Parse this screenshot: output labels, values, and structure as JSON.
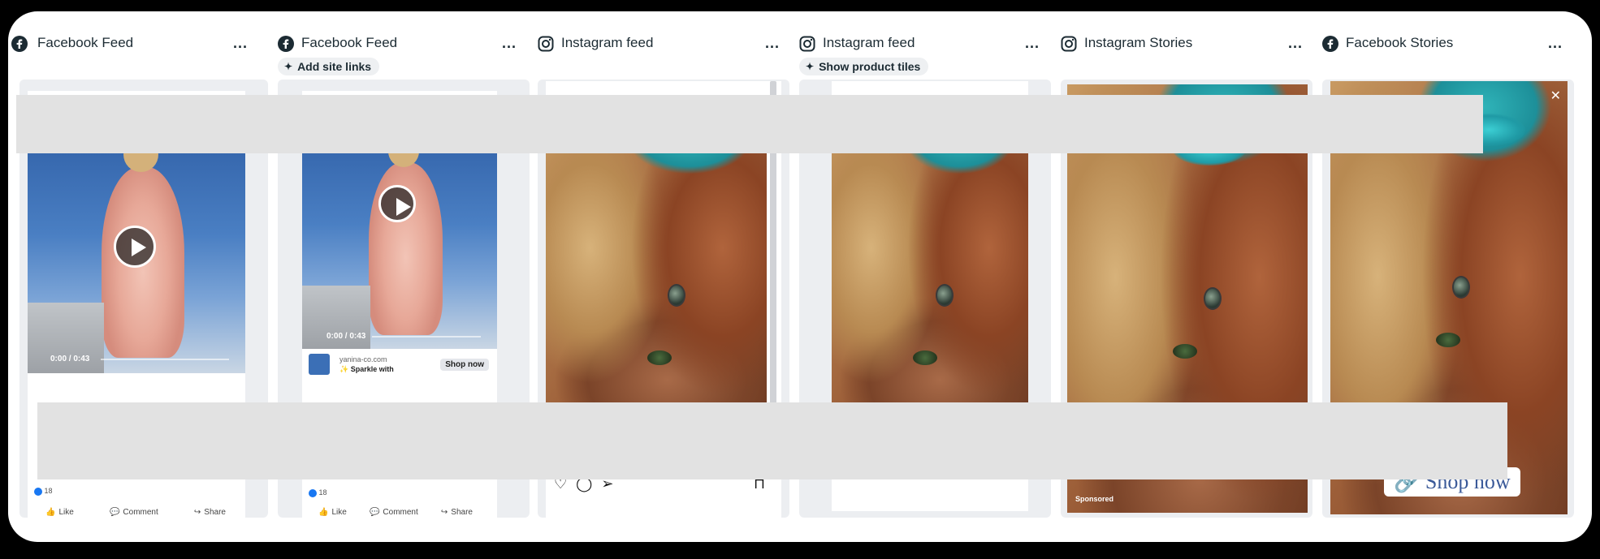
{
  "placements": [
    {
      "platform": "facebook",
      "icon": "facebook-icon",
      "title": "Facebook Feed",
      "chip": null
    },
    {
      "platform": "facebook",
      "icon": "facebook-icon",
      "title": "Facebook Feed",
      "chip": "Add site links"
    },
    {
      "platform": "instagram",
      "icon": "instagram-icon",
      "title": "Instagram feed",
      "chip": null
    },
    {
      "platform": "instagram",
      "icon": "instagram-icon",
      "title": "Instagram feed",
      "chip": "Show product tiles"
    },
    {
      "platform": "instagram",
      "icon": "instagram-icon",
      "title": "Instagram Stories",
      "chip": null
    },
    {
      "platform": "facebook",
      "icon": "facebook-icon",
      "title": "Facebook Stories",
      "chip": null
    }
  ],
  "more_label": "...",
  "fb_feed_1": {
    "video_time": "0:00 / 0:43",
    "reaction_count": "18",
    "like": "Like",
    "comment": "Comment",
    "share": "Share"
  },
  "fb_feed_2": {
    "video_time": "0:00 / 0:43",
    "domain": "yanina-co.com",
    "headline": "✨ Sparkle with",
    "cta": "Shop now",
    "reaction_count": "18",
    "like": "Like",
    "comment": "Comment",
    "share": "Share"
  },
  "ig_stories": {
    "sponsored": "Sponsored"
  },
  "fb_stories": {
    "cta": "Shop now"
  },
  "colors": {
    "facebook_blue": "#1877f2",
    "chip_bg": "#eef0f2",
    "tile_bg": "#eceef1",
    "redaction": "#e2e2e2"
  }
}
